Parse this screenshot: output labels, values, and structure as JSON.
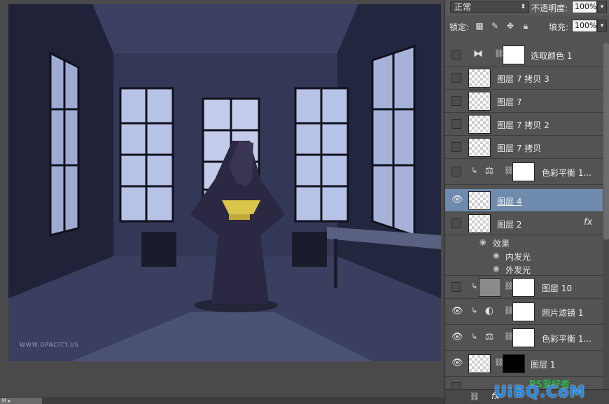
{
  "canvas": {
    "watermark": "WWW.OPACITY.US"
  },
  "panel": {
    "blend_mode": "正常",
    "opacity_label": "不透明度:",
    "opacity_value": "100%",
    "lock_label": "锁定:",
    "fill_label": "填充:",
    "fill_value": "100%"
  },
  "layers": [
    {
      "name": "选取颜色 1",
      "visible": false,
      "type": "adjustment",
      "icon": "selective-color-icon",
      "mask": "white"
    },
    {
      "name": "图层 7 拷贝 3",
      "visible": false,
      "type": "pixel"
    },
    {
      "name": "图层 7",
      "visible": false,
      "type": "pixel"
    },
    {
      "name": "图层 7 拷贝 2",
      "visible": false,
      "type": "pixel"
    },
    {
      "name": "图层 7 拷贝",
      "visible": false,
      "type": "pixel"
    },
    {
      "name": "色彩平衡 1...",
      "visible": false,
      "type": "adjustment",
      "icon": "color-balance-icon",
      "mask": "white",
      "clipped": true
    },
    {
      "name": "图层 4",
      "visible": true,
      "type": "pixel",
      "selected": true
    },
    {
      "name": "图层 2",
      "visible": false,
      "type": "pixel",
      "fx": "fx"
    },
    {
      "name": "图层 10",
      "visible": false,
      "type": "masked",
      "mask": "white",
      "clipped": true
    },
    {
      "name": "照片滤镜 1",
      "visible": true,
      "type": "adjustment",
      "icon": "photo-filter-icon",
      "mask": "white",
      "clipped": true
    },
    {
      "name": "色彩平衡 1...",
      "visible": true,
      "type": "adjustment",
      "icon": "color-balance-icon",
      "mask": "white",
      "clipped": true
    },
    {
      "name": "图层 1",
      "visible": true,
      "type": "masked",
      "mask": "black"
    }
  ],
  "effects": {
    "header": "效果",
    "items": [
      "内发光",
      "外发光"
    ]
  },
  "branding": {
    "logo": "UiBQ.CoM",
    "sub": "PS爱好者"
  }
}
